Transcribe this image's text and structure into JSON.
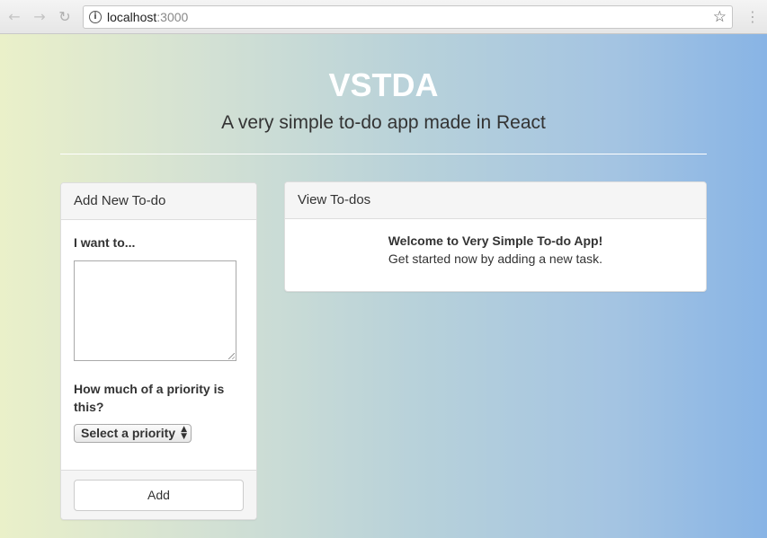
{
  "browser": {
    "url_host": "localhost",
    "url_port": ":3000",
    "icons": [
      "back-arrow-icon",
      "forward-arrow-icon",
      "reload-icon",
      "info-icon",
      "star-icon",
      "menu-icon"
    ]
  },
  "header": {
    "title": "VSTDA",
    "subtitle": "A very simple to-do app made in React"
  },
  "add_panel": {
    "heading": "Add New To-do",
    "want_label": "I want to...",
    "todo_text": "",
    "priority_label": "How much of a priority is this?",
    "priority_selected": "Select a priority",
    "add_button": "Add"
  },
  "view_panel": {
    "heading": "View To-dos",
    "welcome_title": "Welcome to Very Simple To-do App!",
    "welcome_text": "Get started now by adding a new task."
  },
  "colors": {
    "gradient_left": "#eaf0c9",
    "gradient_right": "#88b4e5",
    "title": "#ffffff"
  }
}
